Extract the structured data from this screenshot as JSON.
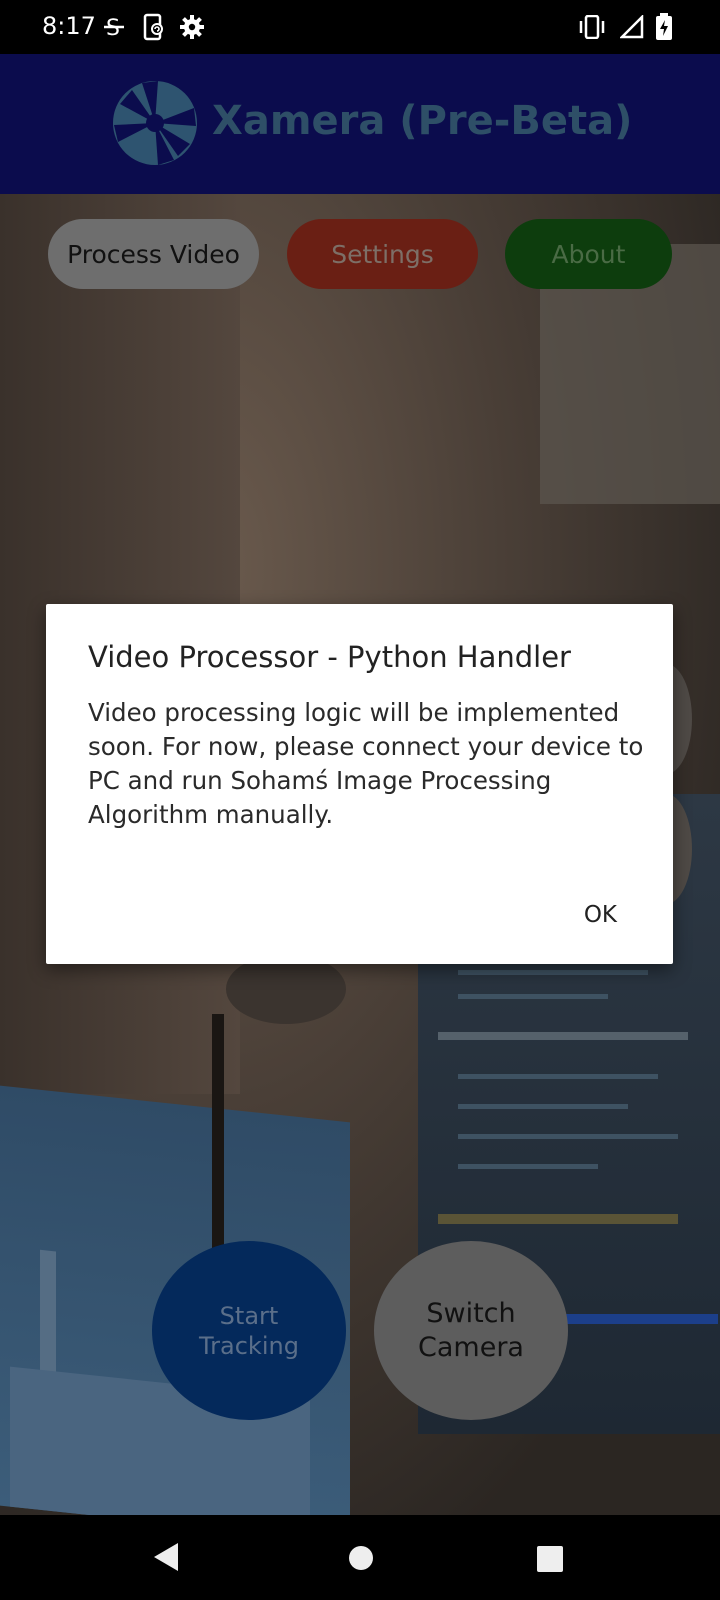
{
  "status_bar": {
    "time": "8:17",
    "left_icons": [
      "strikethrough-s-icon",
      "phone-sync-icon",
      "settings-gear-icon"
    ],
    "right_icons": [
      "vibrate-icon",
      "signal-icon",
      "battery-charging-icon"
    ]
  },
  "app": {
    "title": "Xamera (Pre-Beta)",
    "logo": "aperture-logo",
    "colors": {
      "header": "#0b0c4d",
      "process_video_button": "#6e6e6e",
      "settings_button": "#6a1f14",
      "about_button": "#0d3d0d",
      "start_tracking_button": "#04295b",
      "switch_camera_button": "#5d5d5d"
    }
  },
  "top_buttons": {
    "process_video": "Process Video",
    "settings": "Settings",
    "about": "About"
  },
  "bottom_buttons": {
    "start_tracking_line1": "Start",
    "start_tracking_line2": "Tracking",
    "switch_camera_line1": "Switch",
    "switch_camera_line2": "Camera"
  },
  "dialog": {
    "title": "Video Processor - Python Handler",
    "message": "Video processing logic will be implemented soon. For now, please connect your device to PC and run Sohamś Image Processing Algorithm manually.",
    "ok_label": "OK"
  },
  "nav_bar": {
    "icons": [
      "back-icon",
      "home-icon",
      "recents-icon"
    ]
  }
}
